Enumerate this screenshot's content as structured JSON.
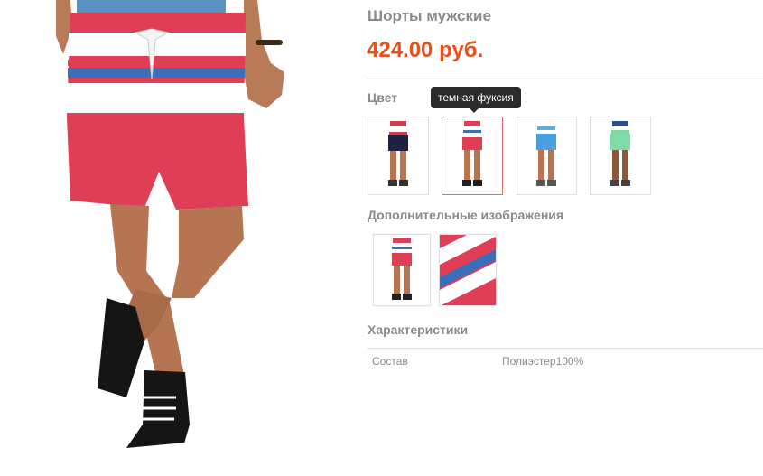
{
  "product": {
    "title": "Шорты мужские",
    "price": "424.00 руб."
  },
  "color_section": {
    "heading": "Цвет",
    "tooltip": "темная фуксия",
    "swatches": [
      {
        "name": "dark-navy",
        "selected": false
      },
      {
        "name": "темная фуксия",
        "selected": true
      },
      {
        "name": "light-blue",
        "selected": false
      },
      {
        "name": "mint-green",
        "selected": false
      }
    ]
  },
  "extra_images": {
    "heading": "Дополнительные изображения"
  },
  "specs": {
    "heading": "Характеристики",
    "rows": [
      {
        "name": "Состав",
        "value": "Полиэстер100%"
      }
    ]
  },
  "colors": {
    "price": "#e8501c",
    "heading": "#8a8a8a",
    "selected_border": "#e86a6a",
    "tooltip_bg": "#2b2b2b"
  }
}
